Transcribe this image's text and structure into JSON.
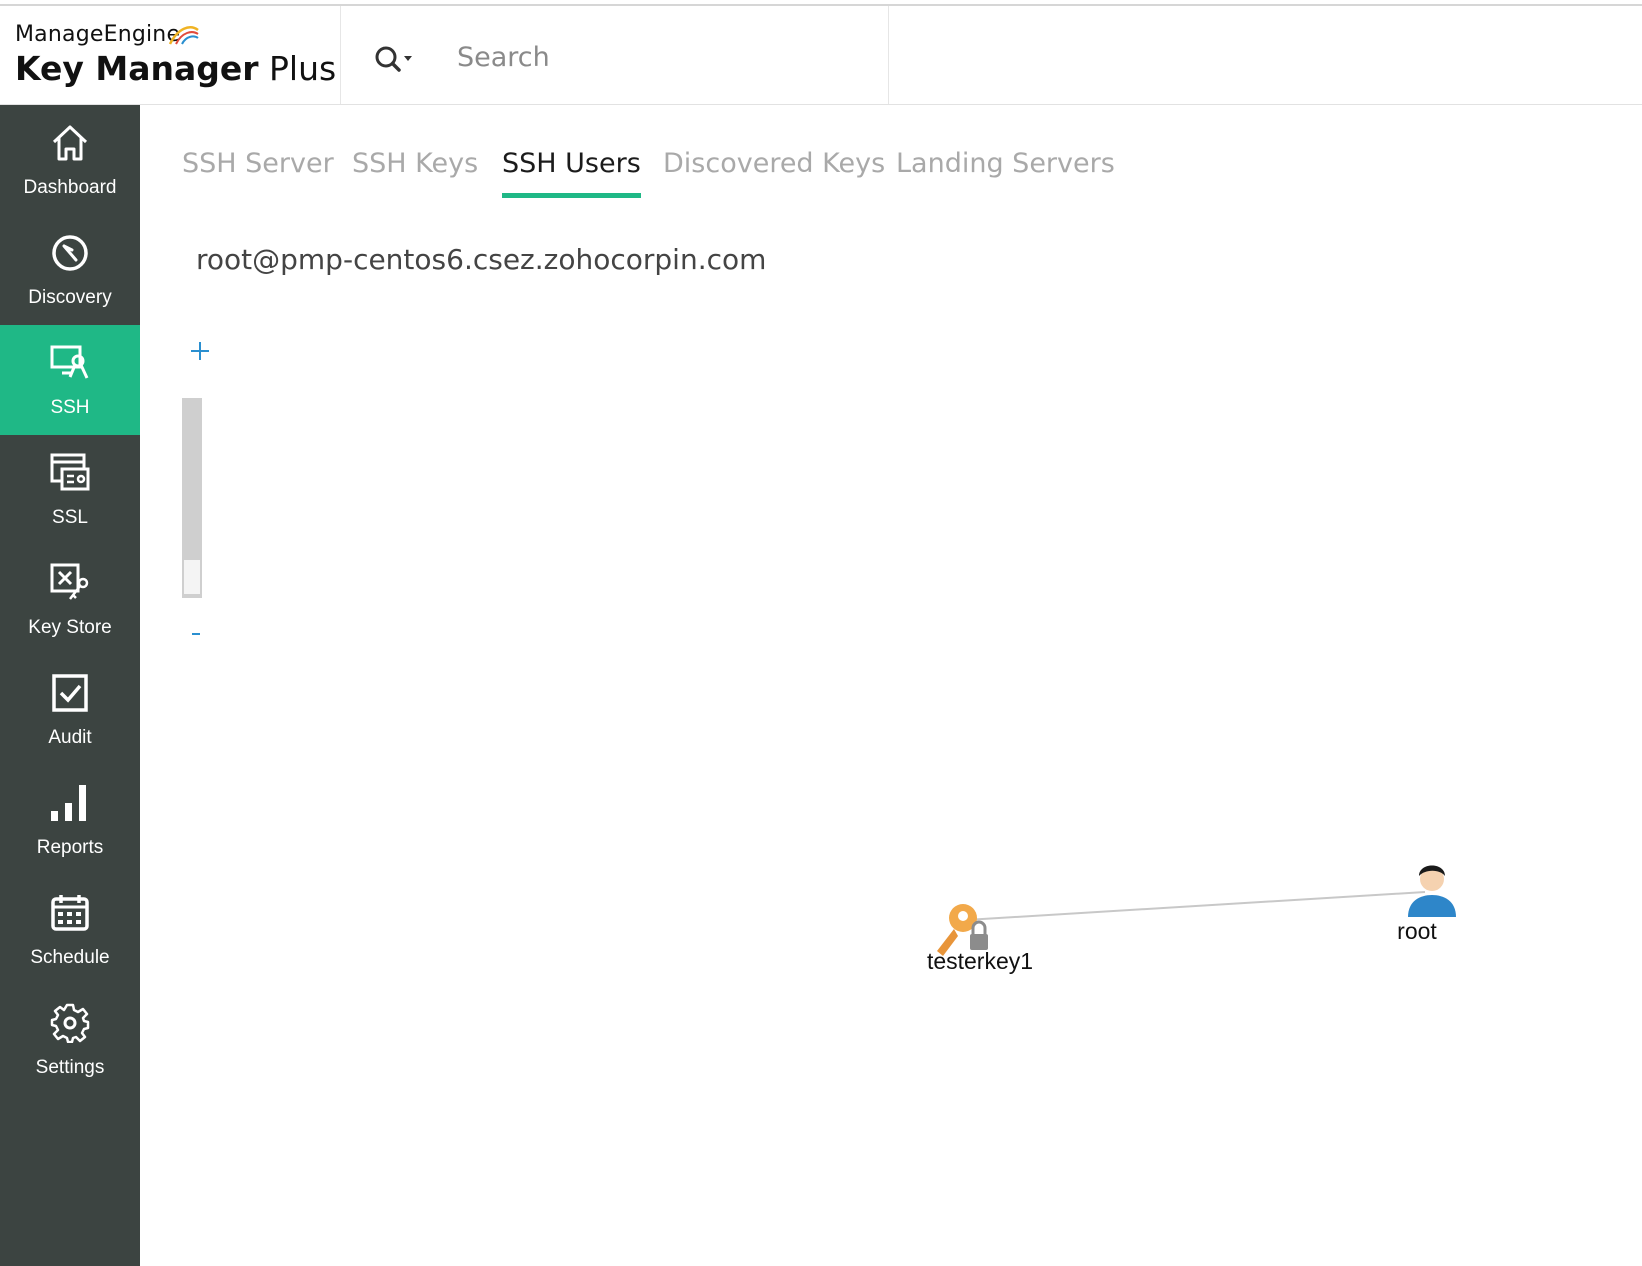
{
  "brand": {
    "vendor": "ManageEngine",
    "product_bold": "Key Manager",
    "product_light": " Plus"
  },
  "search": {
    "placeholder": "Search"
  },
  "sidebar": {
    "items": [
      {
        "label": "Dashboard",
        "icon": "home-icon"
      },
      {
        "label": "Discovery",
        "icon": "compass-icon"
      },
      {
        "label": "SSH",
        "icon": "ssh-monitor-icon",
        "active": true
      },
      {
        "label": "SSL",
        "icon": "certificate-icon"
      },
      {
        "label": "Key Store",
        "icon": "key-store-icon"
      },
      {
        "label": "Audit",
        "icon": "audit-check-icon"
      },
      {
        "label": "Reports",
        "icon": "bar-chart-icon"
      },
      {
        "label": "Schedule",
        "icon": "calendar-icon"
      },
      {
        "label": "Settings",
        "icon": "gear-icon"
      }
    ]
  },
  "tabs": [
    {
      "label": "SSH Server"
    },
    {
      "label": "SSH Keys"
    },
    {
      "label": "SSH Users",
      "active": true
    },
    {
      "label": "Discovered Keys"
    },
    {
      "label": "Landing Servers"
    }
  ],
  "host": {
    "title": "root@pmp-centos6.csez.zohocorpin.com"
  },
  "zoom": {
    "plus": "+",
    "minus": "-"
  },
  "graph": {
    "nodes": [
      {
        "label": "testerkey1",
        "icon": "locked-key-icon"
      },
      {
        "label": "root",
        "icon": "user-icon"
      }
    ],
    "edges": [
      {
        "from": "testerkey1",
        "to": "root"
      }
    ]
  },
  "colors": {
    "accent": "#1fb886",
    "sidebar": "#3c4441",
    "tab_inactive": "#a9a9a9",
    "zoom_control": "#2a8fd0"
  }
}
